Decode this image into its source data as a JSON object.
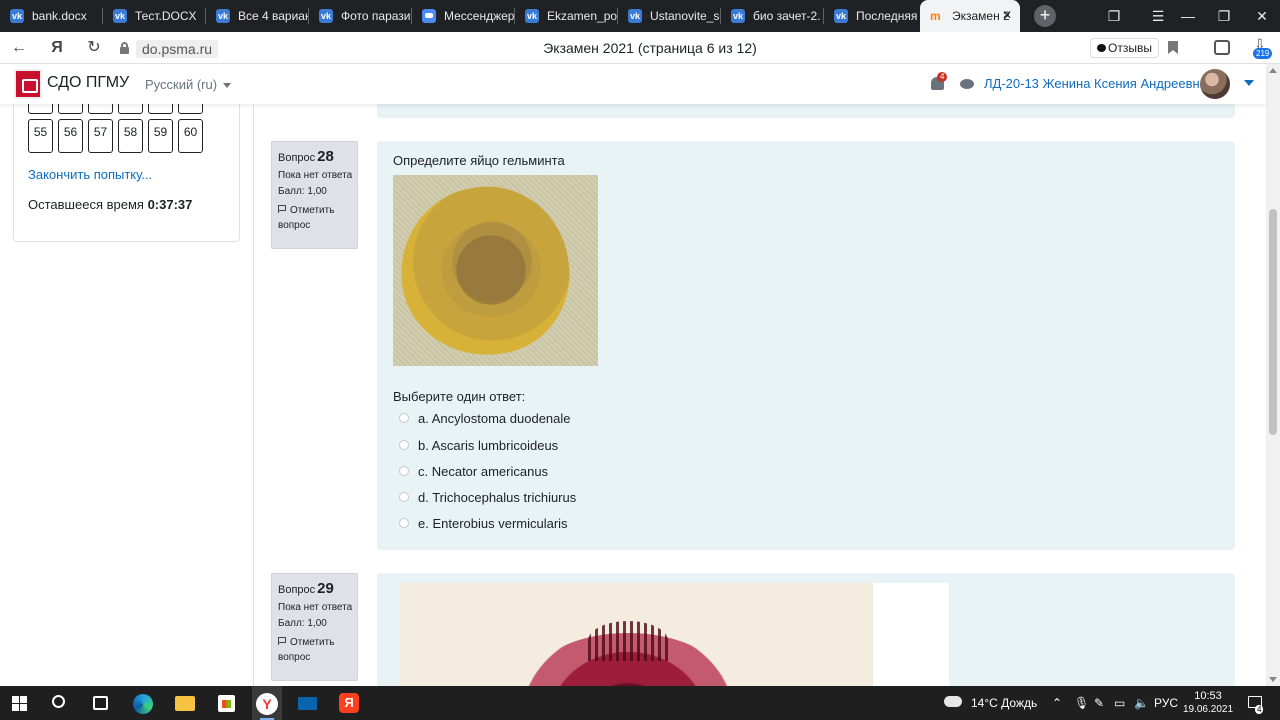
{
  "browser": {
    "tabs": [
      {
        "label": "bank.docx",
        "icon": "vk-icon"
      },
      {
        "label": "Тест.DOCX",
        "icon": "vk-icon"
      },
      {
        "label": "Все 4 вариан",
        "icon": "vk-icon"
      },
      {
        "label": "Фото парази",
        "icon": "vk-icon"
      },
      {
        "label": "Мессенджер",
        "icon": "messenger-icon"
      },
      {
        "label": "Ekzamen_po",
        "icon": "vk-icon"
      },
      {
        "label": "Ustanovite_sc",
        "icon": "vk-icon"
      },
      {
        "label": "био зачет-2.",
        "icon": "vk-icon"
      },
      {
        "label": "Последняя н",
        "icon": "vk-icon"
      },
      {
        "label": "Экзамен 2",
        "icon": "moodle-icon"
      }
    ],
    "url": "do.psma.ru",
    "page_title": "Экзамен 2021 (страница 6 из 12)",
    "reviews_label": "Отзывы",
    "downloads_count": "219"
  },
  "site": {
    "name": "СДО ПГМУ",
    "language": "Русский (ru)",
    "notifications_count": "4",
    "user_name": "ЛД-20-13 Женина Ксения Андреевна"
  },
  "quiz_nav": {
    "buttons": [
      "55",
      "56",
      "57",
      "58",
      "59",
      "60"
    ],
    "finish_label": "Закончить попытку...",
    "time_label": "Оставшееся время",
    "time_value": "0:37:37"
  },
  "questions": [
    {
      "label": "Вопрос",
      "number": "28",
      "state": "Пока нет ответа",
      "grade": "Балл: 1,00",
      "flag_label": "Отметить вопрос",
      "text": "Определите  яйцо гельминта",
      "prompt": "Выберите один ответ:",
      "answers": [
        "a. Ancylostoma duodenale",
        "b. Ascaris lumbricoideus",
        "c. Necator americanus",
        "d. Trichocephalus trichiurus",
        "e. Enterobius vermicularis"
      ]
    },
    {
      "label": "Вопрос",
      "number": "29",
      "state": "Пока нет ответа",
      "grade": "Балл: 1,00",
      "flag_label": "Отметить вопрос"
    }
  ],
  "taskbar": {
    "weather": "14°C  Дождь",
    "lang": "РУС",
    "time": "10:53",
    "date": "19.06.2021",
    "notifications": "4"
  },
  "colors": {
    "link": "#0f6cbf",
    "question_bg": "#e7f3f5",
    "info_bg": "#dee2e6",
    "badge": "#ca3120"
  }
}
